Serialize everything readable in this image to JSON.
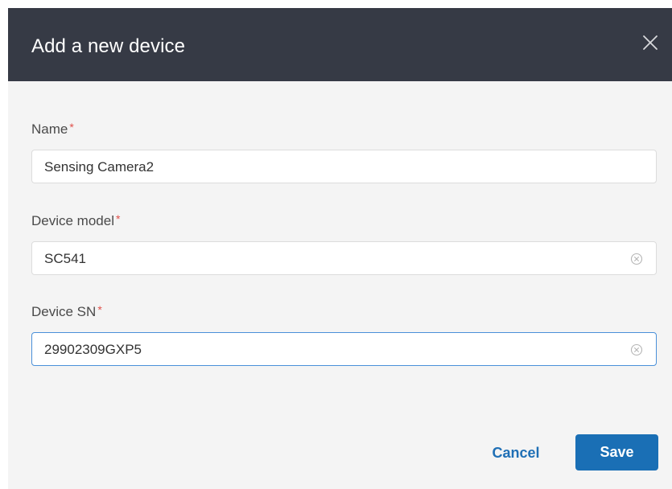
{
  "dialog": {
    "title": "Add a new device",
    "close_icon": "close-icon"
  },
  "fields": {
    "name": {
      "label": "Name",
      "required_mark": "*",
      "value": "Sensing Camera2"
    },
    "device_model": {
      "label": "Device model",
      "required_mark": "*",
      "value": "SC541",
      "clear_icon": "clear-circle-icon"
    },
    "device_sn": {
      "label": "Device SN",
      "required_mark": "*",
      "value": "29902309GXP5",
      "clear_icon": "clear-circle-icon"
    }
  },
  "actions": {
    "cancel_label": "Cancel",
    "save_label": "Save"
  },
  "colors": {
    "header_bg": "#363a45",
    "body_bg": "#f4f4f4",
    "accent": "#1a6fb5",
    "required": "#e0504a",
    "focus_border": "#4a90d9"
  }
}
